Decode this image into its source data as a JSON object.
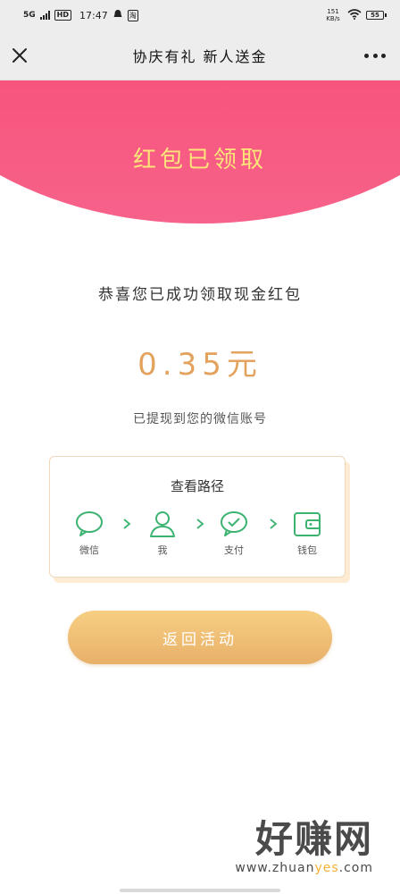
{
  "status_bar": {
    "network": "5G",
    "hd": "HD",
    "time": "17:47",
    "app_icon_text": "淘",
    "speed": "151 KB/s",
    "battery": "55"
  },
  "nav": {
    "title": "协庆有礼 新人送金"
  },
  "banner": {
    "title": "红包已领取"
  },
  "content": {
    "congrats": "恭喜您已成功领取现金红包",
    "amount": "0.35元",
    "withdrawn": "已提现到您的微信账号"
  },
  "path_card": {
    "title": "查看路径",
    "steps": [
      {
        "label": "微信",
        "icon": "wechat-icon"
      },
      {
        "label": "我",
        "icon": "user-icon"
      },
      {
        "label": "支付",
        "icon": "pay-check-icon"
      },
      {
        "label": "钱包",
        "icon": "wallet-icon"
      }
    ],
    "accent_color": "#3cb371"
  },
  "button": {
    "label": "返回活动"
  },
  "watermark": {
    "brand": "好赚网",
    "url_prefix": "www.zhuan",
    "url_highlight": "yes",
    "url_suffix": ".com"
  }
}
